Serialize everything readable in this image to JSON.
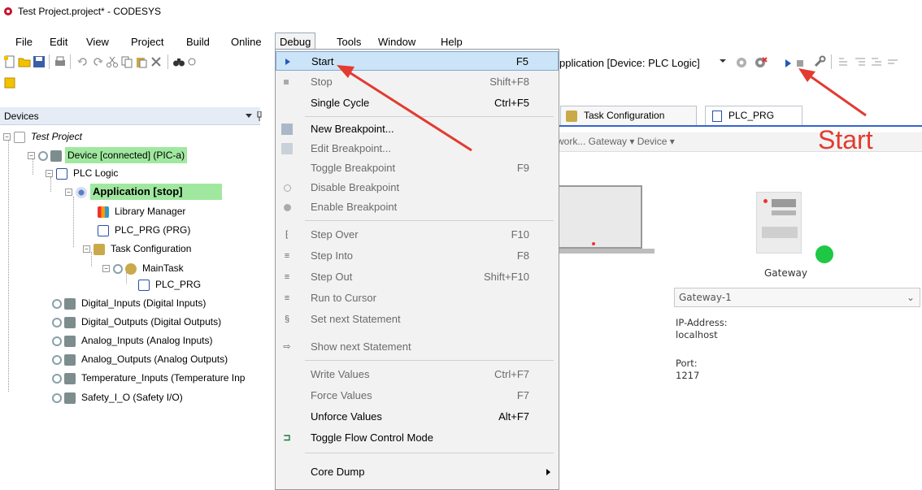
{
  "window": {
    "title": "Test Project.project* - CODESYS"
  },
  "menu": [
    {
      "label": "File"
    },
    {
      "label": "Edit"
    },
    {
      "label": "View"
    },
    {
      "label": "Project"
    },
    {
      "label": "Build"
    },
    {
      "label": "Online"
    },
    {
      "label": "Debug"
    },
    {
      "label": "Tools"
    },
    {
      "label": "Window"
    },
    {
      "label": "Help"
    }
  ],
  "toolbar": {
    "app_selector": "pplication [Device: PLC Logic]"
  },
  "devices": {
    "title": "Devices",
    "tree": [
      {
        "label": "Test Project"
      },
      {
        "label": "Device [connected] (PIC-a)"
      },
      {
        "label": "PLC Logic"
      },
      {
        "label": "Application [stop]"
      },
      {
        "label": "Library Manager"
      },
      {
        "label": "PLC_PRG (PRG)"
      },
      {
        "label": "Task Configuration"
      },
      {
        "label": "MainTask"
      },
      {
        "label": "PLC_PRG"
      },
      {
        "label": "Digital_Inputs (Digital Inputs)"
      },
      {
        "label": "Digital_Outputs (Digital Outputs)"
      },
      {
        "label": "Analog_Inputs (Analog Inputs)"
      },
      {
        "label": "Analog_Outputs (Analog Outputs)"
      },
      {
        "label": "Temperature_Inputs (Temperature Inp"
      },
      {
        "label": "Safety_I_O (Safety I/O)"
      }
    ]
  },
  "tabs": [
    {
      "label": "Task Configuration"
    },
    {
      "label": "PLC_PRG"
    }
  ],
  "subnav": {
    "text": "work...   Gateway ▾   Device ▾"
  },
  "gateway": {
    "label": "Gateway",
    "selected": "Gateway-1",
    "ip_label": "IP-Address:",
    "ip_value": "localhost",
    "port_label": "Port:",
    "port_value": "1217"
  },
  "annotation": {
    "text": "Start",
    "color": "#e23b2f"
  },
  "debug_menu": [
    {
      "label": "Start",
      "shortcut": "F5"
    },
    {
      "label": "Stop",
      "shortcut": "Shift+F8"
    },
    {
      "label": "Single Cycle",
      "shortcut": "Ctrl+F5"
    },
    {
      "label": "New Breakpoint...",
      "shortcut": ""
    },
    {
      "label": "Edit Breakpoint...",
      "shortcut": ""
    },
    {
      "label": "Toggle Breakpoint",
      "shortcut": "F9"
    },
    {
      "label": "Disable Breakpoint",
      "shortcut": ""
    },
    {
      "label": "Enable Breakpoint",
      "shortcut": ""
    },
    {
      "label": "Step Over",
      "shortcut": "F10"
    },
    {
      "label": "Step Into",
      "shortcut": "F8"
    },
    {
      "label": "Step Out",
      "shortcut": "Shift+F10"
    },
    {
      "label": "Run to Cursor",
      "shortcut": ""
    },
    {
      "label": "Set next Statement",
      "shortcut": ""
    },
    {
      "label": "Show next Statement",
      "shortcut": ""
    },
    {
      "label": "Write Values",
      "shortcut": "Ctrl+F7"
    },
    {
      "label": "Force Values",
      "shortcut": "F7"
    },
    {
      "label": "Unforce Values",
      "shortcut": "Alt+F7"
    },
    {
      "label": "Toggle Flow Control Mode",
      "shortcut": ""
    },
    {
      "label": "Core Dump",
      "shortcut": ""
    }
  ]
}
